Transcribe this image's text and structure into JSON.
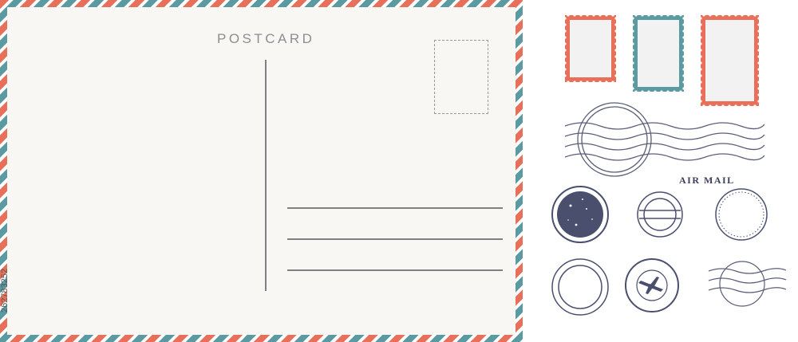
{
  "postcard": {
    "title": "POSTCARD",
    "border_colors": [
      "#e8705a",
      "#5a9aa0"
    ],
    "background": "#f8f7f3"
  },
  "stamps": {
    "red_color": "#e8705a",
    "teal_color": "#5a9aa0",
    "ink_color": "#4a4f6e"
  },
  "postmark": {
    "airmail_label": "AIR MAIL"
  },
  "watermark": {
    "stock_id": "262783252"
  }
}
